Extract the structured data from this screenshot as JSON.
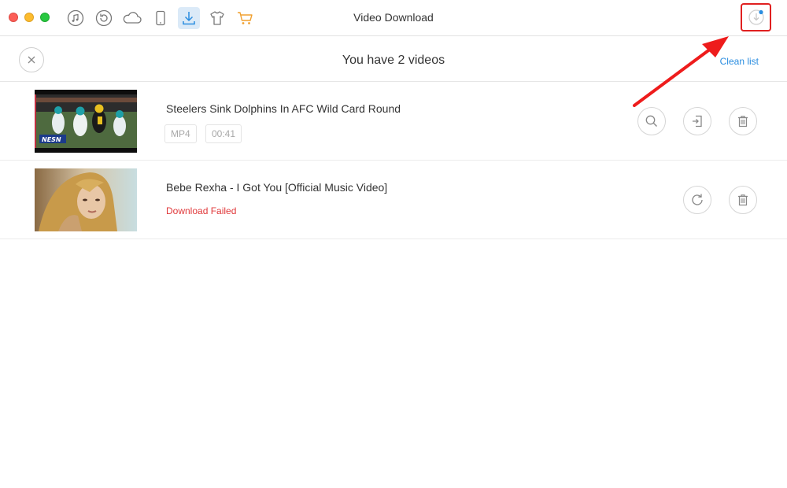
{
  "window": {
    "title": "Video Download"
  },
  "toolbar": {
    "icons": [
      "itunes-library-icon",
      "backup-restore-icon",
      "icloud-icon",
      "device-icon",
      "video-download-icon",
      "ringtone-shirt-icon",
      "store-cart-icon"
    ],
    "active_icon": "video-download-icon",
    "accent_color": "#2a8de0",
    "cart_color": "#f0a030"
  },
  "header": {
    "count_text": "You have 2 videos",
    "clean_list_label": "Clean list"
  },
  "videos": [
    {
      "title": "Steelers Sink Dolphins In AFC Wild Card Round",
      "format": "MP4",
      "duration": "00:41",
      "thumbnail_text": "NESN",
      "actions": [
        "search-icon",
        "import-to-device-icon",
        "trash-icon"
      ]
    },
    {
      "title": "Bebe Rexha - I Got You [Official Music Video]",
      "status": "Download Failed",
      "status_color": "#e0383a",
      "actions": [
        "retry-icon",
        "trash-icon"
      ]
    }
  ],
  "annotation": {
    "highlight_color": "#e02020"
  }
}
